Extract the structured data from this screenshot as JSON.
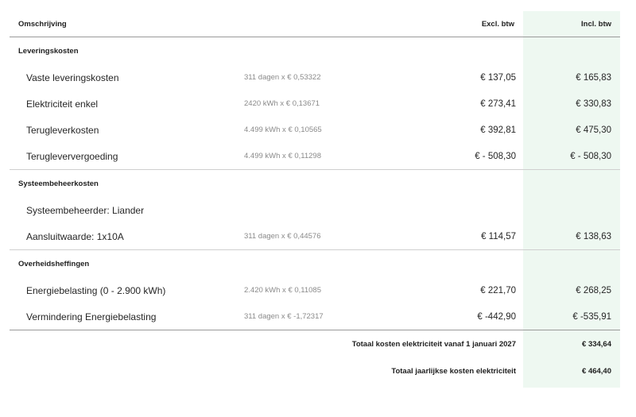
{
  "header": {
    "description": "Omschrijving",
    "excl": "Excl. btw",
    "incl": "Incl. btw"
  },
  "sections": [
    {
      "title": "Leveringskosten",
      "rows": [
        {
          "desc": "Vaste leveringskosten",
          "calc": "311 dagen x € 0,53322",
          "excl": "€ 137,05",
          "incl": "€ 165,83"
        },
        {
          "desc": "Elektriciteit enkel",
          "calc": "2420 kWh x € 0,13671",
          "excl": "€ 273,41",
          "incl": "€ 330,83"
        },
        {
          "desc": "Terugleverkosten",
          "calc": "4.499 kWh x € 0,10565",
          "excl": "€ 392,81",
          "incl": "€ 475,30"
        },
        {
          "desc": "Terugleververgoeding",
          "calc": "4.499 kWh x € 0,11298",
          "excl": "€ - 508,30",
          "incl": "€ - 508,30"
        }
      ]
    },
    {
      "title": "Systeembeheerkosten",
      "rows": [
        {
          "desc": "Systeembeheerder: Liander",
          "calc": "",
          "excl": "",
          "incl": ""
        },
        {
          "desc": "Aansluitwaarde: 1x10A",
          "calc": "311 dagen x € 0,44576",
          "excl": "€ 114,57",
          "incl": "€ 138,63"
        }
      ]
    },
    {
      "title": "Overheidsheffingen",
      "rows": [
        {
          "desc": "Energiebelasting (0 - 2.900 kWh)",
          "calc": "2.420 kWh x € 0,11085",
          "excl": "€ 221,70",
          "incl": "€ 268,25"
        },
        {
          "desc": "Vermindering Energiebelasting",
          "calc": "311 dagen x € -1,72317",
          "excl": "€ -442,90",
          "incl": "€ -535,91"
        }
      ]
    }
  ],
  "totals": [
    {
      "label": "Totaal kosten elektriciteit vanaf 1 januari 2027",
      "value": "€ 334,64"
    },
    {
      "label": "Totaal jaarlijkse kosten elektriciteit",
      "value": "€ 464,40"
    }
  ],
  "colors": {
    "highlight_column": "#eef8f1",
    "rule": "#9a9a9a"
  }
}
